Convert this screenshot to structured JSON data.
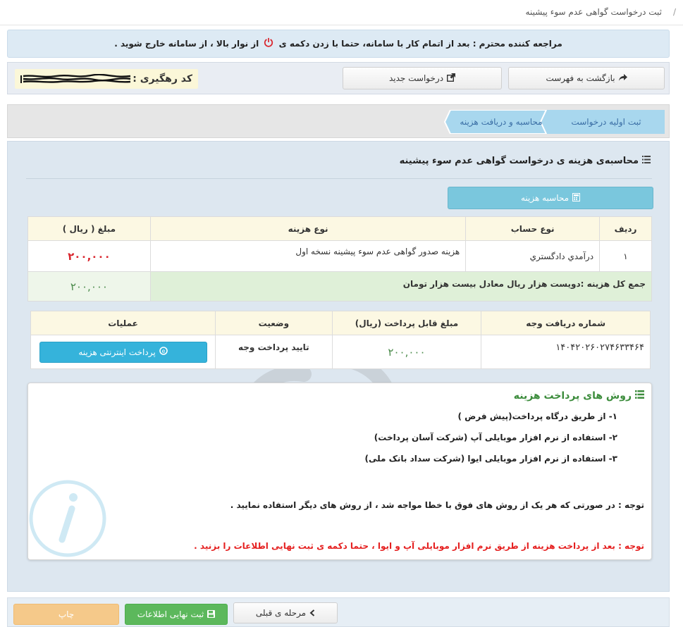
{
  "breadcrumb": {
    "separator": "/",
    "current": "ثبت درخواست گواهی عدم سوء پیشینه"
  },
  "notice": {
    "part1": "مراجعه کننده محترم : بعد از اتمام کار با سامانه، حتما با زدن دکمه ی",
    "part2": "از نوار بالا ، از سامانه خارج شوید ."
  },
  "actions": {
    "back_label": "بازگشت به فهرست",
    "new_label": "درخواست جدید",
    "tracking_label": "کد رهگیری :"
  },
  "steps": [
    {
      "label": "ثبت اولیه درخواست"
    },
    {
      "label": "محاسبه و دریافت هزینه"
    }
  ],
  "main": {
    "title": "محاسبه‌ی هزینه ی درخواست گواهی عدم سوء پیشینه",
    "calc_button": "محاسبه هزینه"
  },
  "cost_table": {
    "headers": {
      "row": "ردیف",
      "account": "نوع حساب",
      "cost_type": "نوع هزینه",
      "amount": "مبلغ ( ریال )"
    },
    "rows": [
      {
        "row": "۱",
        "account": "درآمدي دادگستري",
        "cost_type": "هزینه صدور گواهی عدم سوء پیشینه نسخه اول",
        "amount": "۲۰۰,۰۰۰"
      }
    ],
    "total_label": "جمع کل هزینه :دویست هزار ریال معادل بیست هزار تومان",
    "total_amount": "۲۰۰,۰۰۰"
  },
  "payment_table": {
    "headers": {
      "receipt_no": "شماره دریافت وجه",
      "payable": "مبلغ قابل پرداخت (ریال)",
      "status": "وضعیت",
      "operations": "عملیات"
    },
    "row": {
      "receipt_no": "۱۴۰۴۲۰۲۶۰۲۷۴۶۳۳۴۶۴",
      "payable": "۲۰۰,۰۰۰",
      "status": "تایید پرداخت وجه",
      "pay_button": "پرداخت اینترنتی هزینه"
    }
  },
  "methods": {
    "title": "روش های پرداخت هزینه",
    "items": [
      "۱- از طریق درگاه پرداخت(پیش فرض )",
      "۲- استفاده از نرم افزار موبایلی آپ (شرکت آسان پرداخت)",
      "۳- استفاده از نرم افزار موبایلی ایوا (شرکت سداد بانک ملی)"
    ],
    "note1": "توجه : در صورتی که هر یک از روش های فوق با خطا مواجه شد ، از روش های دیگر استفاده نمایید .",
    "note2": "توجه : بعد از پرداخت هزینه از طریق نرم افزار موبایلی آپ و ایوا ، حتما دکمه ی ثبت نهایی اطلاعات را بزنید ."
  },
  "bottom": {
    "prev_label": "مرحله ی قبلی",
    "final_label": "ثبت نهایی اطلاعات",
    "print_label": "چاپ"
  },
  "colors": {
    "accent": "#35b3db",
    "danger": "#d9262e",
    "success": "#5cb85c",
    "warning": "#f5c98a"
  }
}
